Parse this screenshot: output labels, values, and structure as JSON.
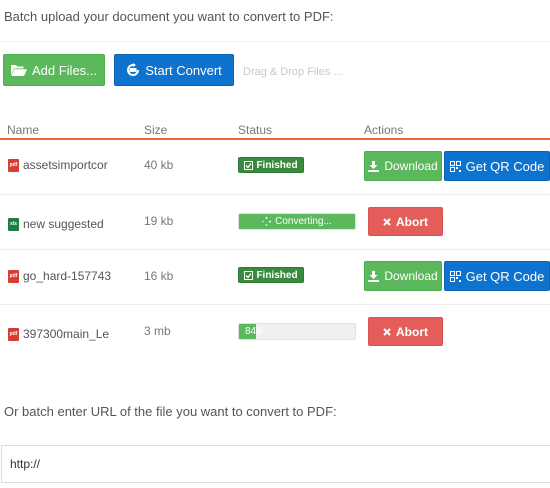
{
  "upload": {
    "intro": "Batch upload your document you want to convert to PDF:",
    "add_files_label": "Add Files...",
    "start_convert_label": "Start Convert",
    "drag_drop_hint": "Drag & Drop Files ..."
  },
  "table": {
    "headers": {
      "name": "Name",
      "size": "Size",
      "status": "Status",
      "actions": "Actions"
    },
    "rows": [
      {
        "file_type": "pdf",
        "name": "assetsimportcor",
        "size": "40 kb",
        "status": "Finished",
        "actions": [
          "Download",
          "Get QR Code"
        ]
      },
      {
        "file_type": "xls",
        "name": "new suggested",
        "size": "19 kb",
        "status": "Converting...",
        "progress_percent": 100,
        "actions": [
          "Abort"
        ]
      },
      {
        "file_type": "pdf",
        "name": "go_hard-157743",
        "size": "16 kb",
        "status": "Finished",
        "actions": [
          "Download",
          "Get QR Code"
        ]
      },
      {
        "file_type": "pdf",
        "name": "397300main_Le",
        "size": "3 mb",
        "status": "848",
        "progress_percent": 15,
        "actions": [
          "Abort"
        ]
      }
    ]
  },
  "url_section": {
    "label": "Or batch enter URL of the file you want to convert to PDF:",
    "input_value": "http://"
  },
  "colors": {
    "green": "#5cb85c",
    "blue": "#0e73cf",
    "red": "#e35d5a",
    "accent_line": "#e8673a",
    "finished_badge": "#3a8a3e"
  },
  "icons": {
    "add_files": "folder-open-icon",
    "start_convert": "refresh-icon",
    "finished": "check-square-icon",
    "converting": "spinner-icon",
    "download": "download-icon",
    "qr": "qrcode-icon",
    "abort": "times-icon",
    "pdf": "pdf-file-icon",
    "xls": "excel-file-icon"
  }
}
